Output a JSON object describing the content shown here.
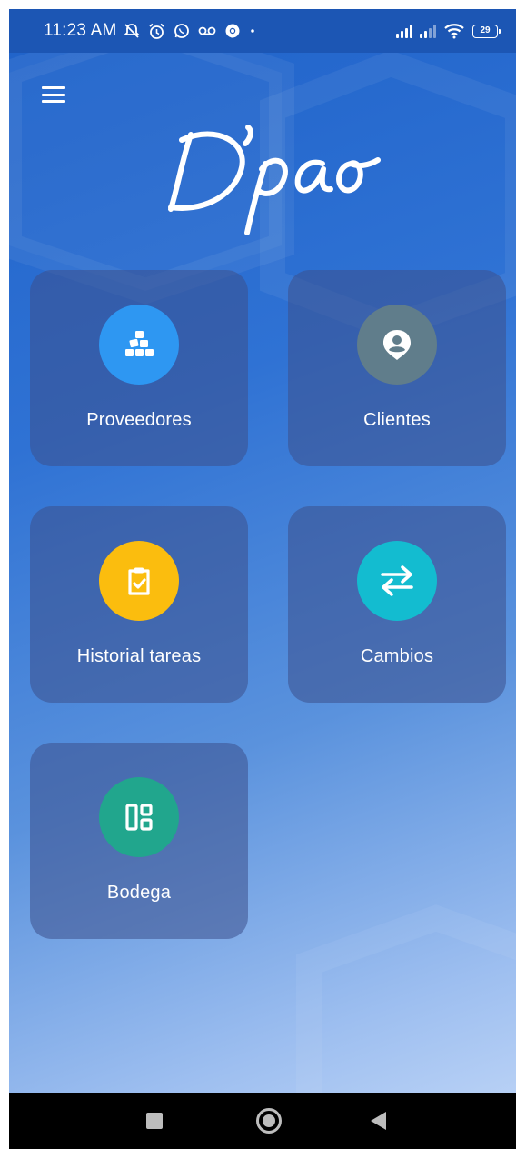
{
  "status_bar": {
    "time": "11:23 AM",
    "battery": "29",
    "left_icons": [
      "notifications-off-icon",
      "alarm-icon",
      "whatsapp-icon",
      "voicemail-icon",
      "chrome-icon",
      "dot-icon"
    ],
    "right_icons": [
      "signal-icon",
      "signal-icon",
      "wifi-icon",
      "battery-icon"
    ]
  },
  "header": {
    "menu_icon": "hamburger-menu-icon",
    "logo_text": "D'pao"
  },
  "tiles": [
    {
      "label": "Proveedores",
      "icon": "boxes-icon",
      "color": "#2e97f2"
    },
    {
      "label": "Clientes",
      "icon": "user-pin-icon",
      "color": "#607d8b"
    },
    {
      "label": "Historial tareas",
      "icon": "clipboard-check-icon",
      "color": "#fbbd0e"
    },
    {
      "label": "Cambios",
      "icon": "swap-arrows-icon",
      "color": "#13bcd0"
    },
    {
      "label": "Bodega",
      "icon": "dashboard-layout-icon",
      "color": "#21a68d"
    }
  ],
  "nav_bar": {
    "icons": [
      "recent-apps-icon",
      "home-icon",
      "back-icon"
    ]
  },
  "colors": {
    "background_top": "#1f62c9",
    "background_bottom": "#b7d0f5",
    "card": "#3c508c"
  }
}
